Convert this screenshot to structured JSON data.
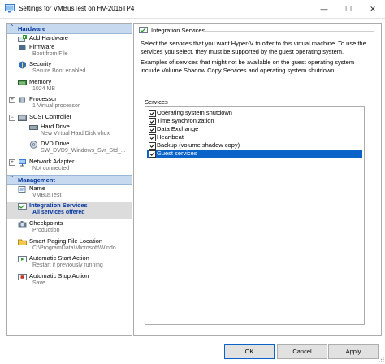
{
  "window": {
    "title": "Settings for VMBusTest on HV-2016TP4",
    "minimize_glyph": "—",
    "maximize_glyph": "☐",
    "close_glyph": "✕"
  },
  "sidebar": {
    "hardware_header": "Hardware",
    "management_header": "Management",
    "hardware_items": [
      {
        "label": "Add Hardware",
        "sub": ""
      },
      {
        "label": "Firmware",
        "sub": "Boot from File"
      },
      {
        "label": "Security",
        "sub": "Secure Boot enabled"
      },
      {
        "label": "Memory",
        "sub": "1024 MB"
      },
      {
        "label": "Processor",
        "sub": "1 Virtual processor"
      },
      {
        "label": "SCSI Controller",
        "sub": ""
      },
      {
        "label": "Hard Drive",
        "sub": "New Virtual Hard Disk.vhdx"
      },
      {
        "label": "DVD Drive",
        "sub": "SW_DVD9_Windows_Svr_Std_..."
      },
      {
        "label": "Network Adapter",
        "sub": "Not connected"
      }
    ],
    "management_items": [
      {
        "label": "Name",
        "sub": "VMBusTest"
      },
      {
        "label": "Integration Services",
        "sub": "All services offered"
      },
      {
        "label": "Checkpoints",
        "sub": "Production"
      },
      {
        "label": "Smart Paging File Location",
        "sub": "C:\\ProgramData\\Microsoft\\Windo..."
      },
      {
        "label": "Automatic Start Action",
        "sub": "Restart if previously running"
      },
      {
        "label": "Automatic Stop Action",
        "sub": "Save"
      }
    ],
    "expander_collapsed": "+",
    "expander_expanded": "−"
  },
  "main": {
    "group_title": "Integration Services",
    "description1": "Select the services that you want Hyper-V to offer to this virtual machine. To use the services you select, they must be supported by the guest operating system.",
    "description2": "Examples of services that might not be available on the guest operating system include Volume Shadow Copy Services and operating system shutdown.",
    "services_label": "Services",
    "services": [
      {
        "label": "Operating system shutdown",
        "checked": true
      },
      {
        "label": "Time synchronization",
        "checked": true
      },
      {
        "label": "Data Exchange",
        "checked": true
      },
      {
        "label": "Heartbeat",
        "checked": true
      },
      {
        "label": "Backup (volume shadow copy)",
        "checked": true
      },
      {
        "label": "Guest services",
        "checked": true
      }
    ]
  },
  "buttons": {
    "ok": "OK",
    "cancel": "Cancel",
    "apply": "Apply"
  },
  "colors": {
    "accent": "#0a63c9",
    "section_header_bg": "#c6d9ef",
    "selected_text": "#0033a0"
  }
}
